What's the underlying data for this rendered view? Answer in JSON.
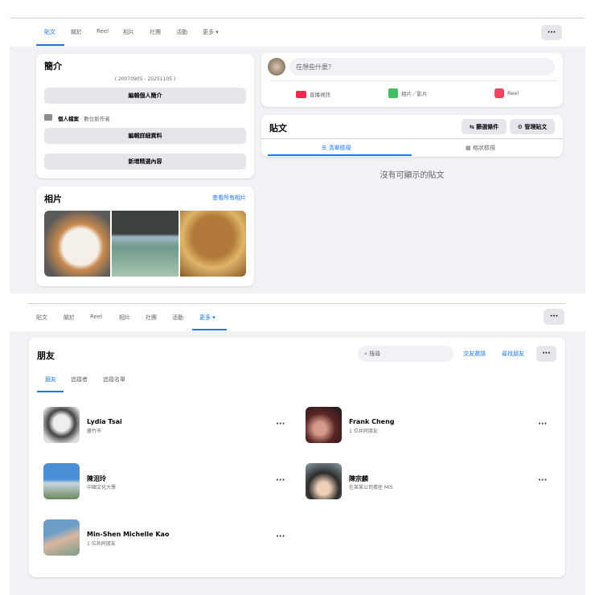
{
  "profile_tabs": [
    "貼文",
    "關於",
    "Reel",
    "相片",
    "社團",
    "活動",
    "更多"
  ],
  "intro": {
    "title": "簡介",
    "dates": "( 20070905 - 20251105 )",
    "edit_bio": "編輯個人簡介",
    "profile_label": "個人檔案",
    "profile_type": " · 數位創作者",
    "edit_details": "編輯詳細資料",
    "add_featured": "新增精選內容"
  },
  "photos": {
    "title": "相片",
    "see_all": "查看所有相片"
  },
  "composer": {
    "placeholder": "在想些什麼？",
    "live": "直播視訊",
    "photo": "相片／影片",
    "reel": "Reel"
  },
  "posts": {
    "title": "貼文",
    "filter": "篩選條件",
    "manage": "管理貼文",
    "list_view": "清單檢視",
    "grid_view": "格狀檢視",
    "empty": "沒有可顯示的貼文"
  },
  "more_label": "···",
  "friends": {
    "title": "朋友",
    "search_placeholder": "搜尋",
    "requests": "交友邀請",
    "find": "尋找朋友",
    "tabs": [
      "朋友",
      "追蹤者",
      "追蹤名單"
    ],
    "list": [
      {
        "name": "Lydia Tsai",
        "sub": "蘆竹市"
      },
      {
        "name": "Frank Cheng",
        "sub": "1 位共同朋友"
      },
      {
        "name": "陳泪玲",
        "sub": "中國文化大學"
      },
      {
        "name": "陳宗麟",
        "sub": "在某某公司擔任 MIS"
      },
      {
        "name": "Min-Shen Michelle Kao",
        "sub": "1 位共同朋友"
      }
    ]
  }
}
